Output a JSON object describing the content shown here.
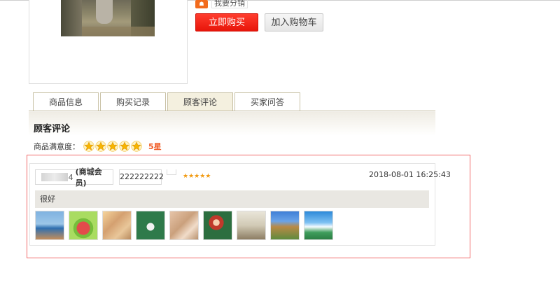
{
  "product": {
    "share_text": "我要分销",
    "buy_now_label": "立即购买",
    "add_to_cart_label": "加入购物车"
  },
  "tabs": [
    {
      "label": "商品信息",
      "active": false
    },
    {
      "label": "购买记录",
      "active": false
    },
    {
      "label": "顾客评论",
      "active": true
    },
    {
      "label": "买家问答",
      "active": false
    }
  ],
  "reviews_section": {
    "title": "顾客评论",
    "satisfaction_label": "商品满意度：",
    "satisfaction_stars": 5,
    "satisfaction_value": "5星"
  },
  "review": {
    "reviewer_name_visible": "4",
    "reviewer_level": "(商城会员)",
    "reviewer_id": "222222222",
    "rating_stars": 5,
    "timestamp": "2018-08-01 16:25:43",
    "text": "很好",
    "image_count": 9
  },
  "colors": {
    "buy_button": "#e8150a",
    "accent_orange": "#f05a24",
    "highlight_border": "#f06b6b"
  }
}
